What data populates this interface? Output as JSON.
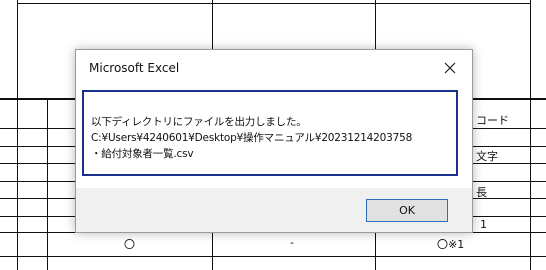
{
  "dialog": {
    "title": "Microsoft Excel",
    "message_lines": [
      "以下ディレクトリにファイルを出力しました。",
      "C:¥Users¥4240601¥Desktop¥操作マニュアル¥20231214203758",
      "・給付対象者一覧.csv"
    ],
    "ok_label": "OK",
    "close_icon": "close-icon"
  },
  "sheet": {
    "partial_cells": {
      "r1": "コード",
      "r2": "文字",
      "r3": "長",
      "r4": "1"
    },
    "bottom_row": [
      "〇",
      "-",
      "〇※1"
    ]
  }
}
